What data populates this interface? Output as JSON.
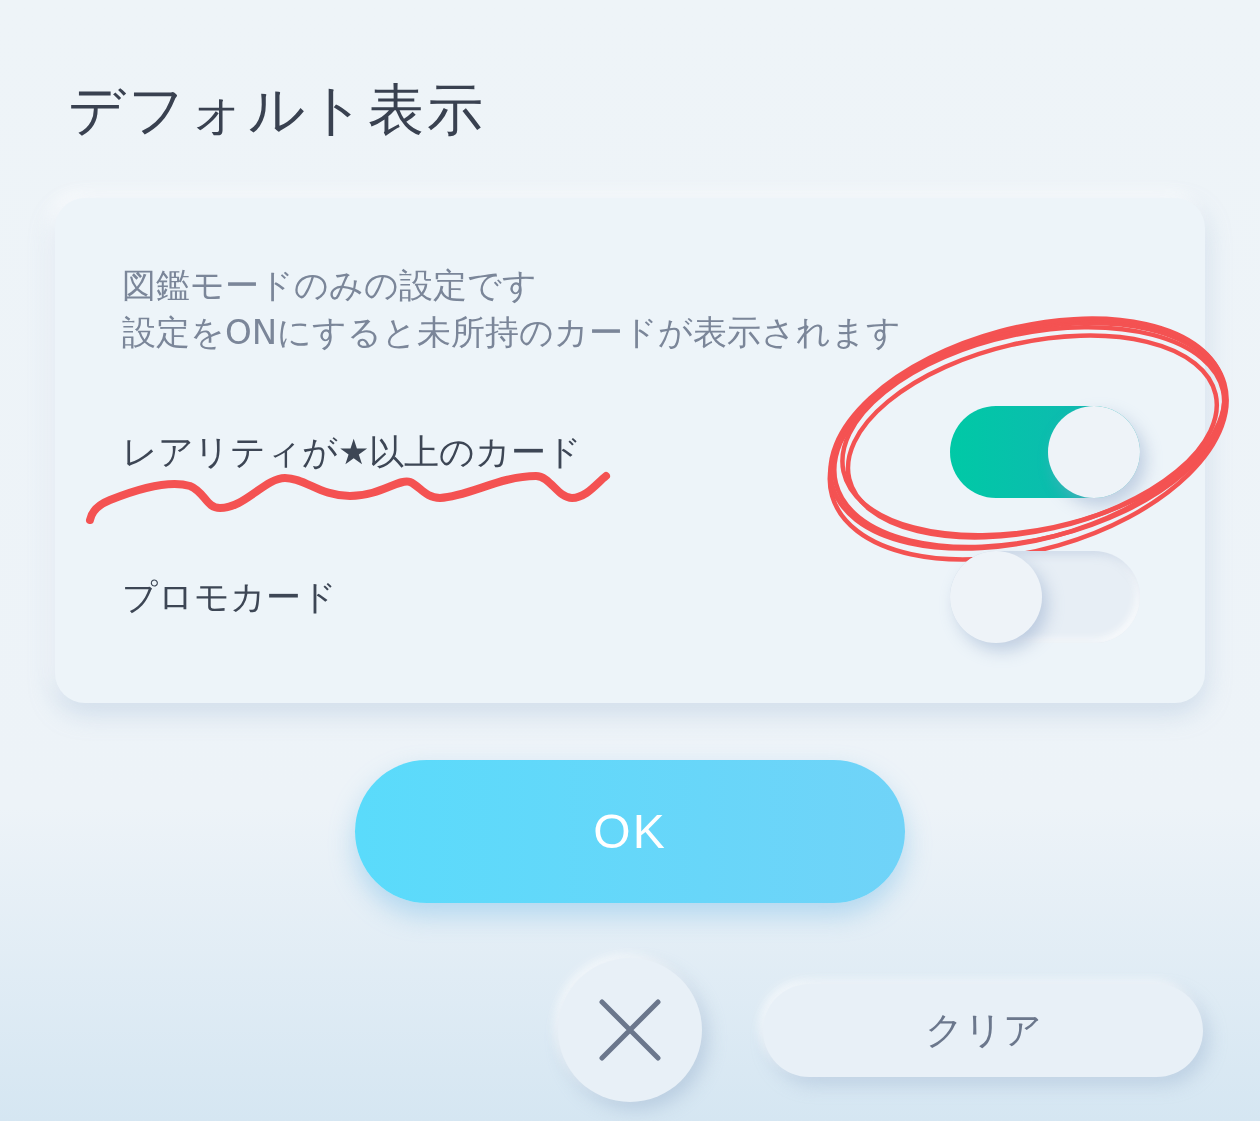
{
  "title": "デフォルト表示",
  "settings": {
    "notes": [
      "図鑑モードのみの設定です",
      "設定をONにすると未所持のカードが表示されます"
    ],
    "options": [
      {
        "label": "レアリティが★以上のカード",
        "on": true,
        "underlined": true,
        "circled": true
      },
      {
        "label": "プロモカード",
        "on": false,
        "underlined": false,
        "circled": false
      }
    ]
  },
  "buttons": [
    {
      "kind": "confirm",
      "label": "OK"
    },
    {
      "kind": "close"
    },
    {
      "kind": "clear",
      "label": "クリア"
    }
  ]
}
